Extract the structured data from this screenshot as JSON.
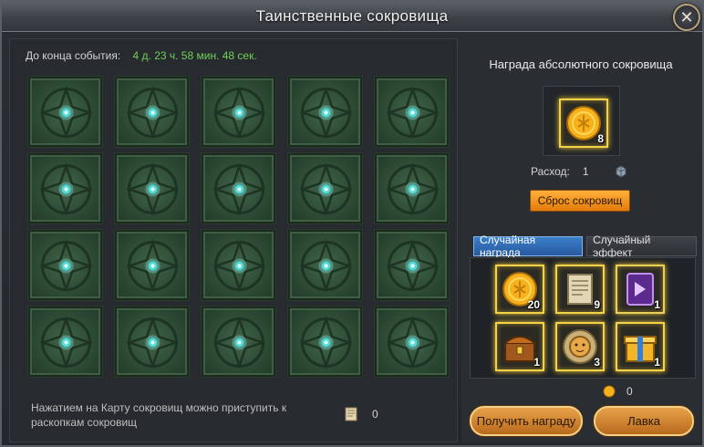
{
  "window": {
    "title": "Таинственные сокровища"
  },
  "event": {
    "timer_label": "До конца события:",
    "timer_value": "4 д. 23 ч. 58 мин. 48 сек."
  },
  "grid": {
    "rows": 4,
    "cols": 5
  },
  "hint": {
    "text": "Нажатием на Карту сокровищ можно приступить к раскопкам сокровищ"
  },
  "treasure_map": {
    "count": "0"
  },
  "absolute": {
    "title": "Награда абсолютного сокровища",
    "item_qty": "8"
  },
  "cost": {
    "label": "Расход:",
    "value": "1"
  },
  "reset_button": {
    "label": "Сброс сокровищ"
  },
  "tabs": [
    {
      "label": "Случайная награда",
      "active": true
    },
    {
      "label": "Случайный эффект",
      "active": false
    }
  ],
  "rewards": [
    {
      "icon": "gold-coin-icon",
      "qty": "20"
    },
    {
      "icon": "scroll-icon",
      "qty": "9"
    },
    {
      "icon": "purple-card-icon",
      "qty": "1"
    },
    {
      "icon": "treasure-chest-icon",
      "qty": "1"
    },
    {
      "icon": "lion-medal-icon",
      "qty": "3"
    },
    {
      "icon": "gift-box-icon",
      "qty": "1"
    }
  ],
  "currency": {
    "value": "0"
  },
  "buttons": {
    "get_reward": "Получить награду",
    "shop": "Лавка"
  },
  "colors": {
    "timer": "#6fd15a",
    "accent_orange": "#e37b0a",
    "tab_blue": "#2f6bb3",
    "tile_green": "#2c4a34"
  }
}
